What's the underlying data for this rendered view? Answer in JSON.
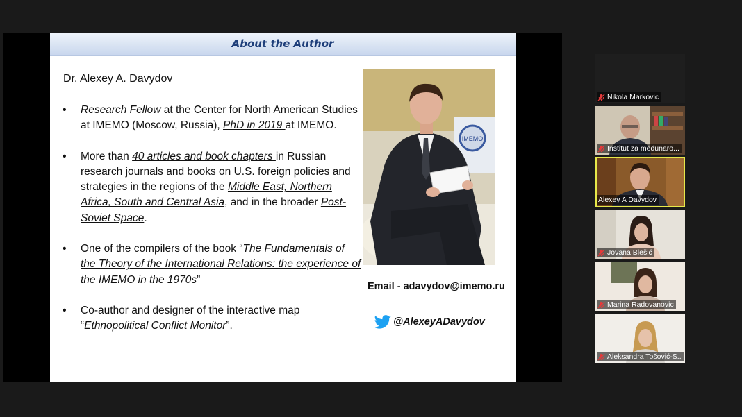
{
  "slide": {
    "title": "About the Author",
    "author": "Dr. Alexey A. Davydov",
    "bullets": [
      {
        "parts": [
          {
            "text": "Research Fellow ",
            "link": true
          },
          {
            "text": "at the Center for North American Studies at IMEMO (Moscow, Russia), ",
            "link": false
          },
          {
            "text": "PhD in 2019 ",
            "link": true
          },
          {
            "text": "at IMEMO.",
            "link": false
          }
        ]
      },
      {
        "parts": [
          {
            "text": "More than ",
            "link": false
          },
          {
            "text": "40 articles and book chapters ",
            "link": true
          },
          {
            "text": "in Russian research journals and books on U.S. foreign policies and strategies in the regions of the ",
            "link": false
          },
          {
            "text": "Middle East, Northern Africa, South and Central Asia",
            "link": true
          },
          {
            "text": ", and in the broader ",
            "link": false
          },
          {
            "text": "Post-Soviet Space",
            "link": true
          },
          {
            "text": ".",
            "link": false
          }
        ]
      },
      {
        "parts": [
          {
            "text": "One of the compilers of the book “",
            "link": false
          },
          {
            "text": "The Fundamentals of the Theory of the International Relations: the experience of the IMEMO in the 1970s",
            "link": true
          },
          {
            "text": "”",
            "link": false
          }
        ]
      },
      {
        "parts": [
          {
            "text": "Co-author and designer of the interactive map “",
            "link": false
          },
          {
            "text": "Ethnopolitical Conflict Monitor",
            "link": true
          },
          {
            "text": "”.",
            "link": false
          }
        ]
      }
    ],
    "email_line": "Email - adavydov@imemo.ru",
    "twitter_handle": "@AlexeyADavydov",
    "photo_sign_text": "IMEMO"
  },
  "participants": [
    {
      "name": "Nikola Markovic",
      "muted": true,
      "video": false,
      "active": false
    },
    {
      "name": "Institut za međunaro...",
      "muted": true,
      "video": true,
      "active": false
    },
    {
      "name": "Alexey A Davydov",
      "muted": false,
      "video": true,
      "active": true
    },
    {
      "name": "Jovana Blešić",
      "muted": true,
      "video": true,
      "active": false
    },
    {
      "name": "Marina Radovanovic",
      "muted": true,
      "video": true,
      "active": false
    },
    {
      "name": "Aleksandra Tošović-S...",
      "muted": true,
      "video": true,
      "active": false
    }
  ],
  "colors": {
    "title": "#1f3f7a",
    "twitter": "#1da1f2",
    "active_border": "#e6e84a",
    "mute": "#e5393a"
  }
}
